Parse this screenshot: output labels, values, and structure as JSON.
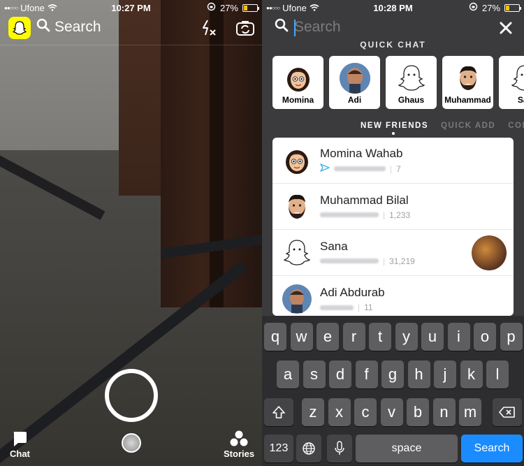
{
  "left": {
    "status": {
      "carrier": "Ufone",
      "time": "10:27 PM",
      "battery": "27%",
      "battery_level": 0.27
    },
    "search_label": "Search",
    "icons": {
      "ghost": "snapchat-ghost-icon",
      "search": "search-icon",
      "flash": "flash-off-icon",
      "flip": "flip-camera-icon",
      "chat": "chat-icon",
      "stories": "stories-icon"
    },
    "bottom": {
      "chat": "Chat",
      "stories": "Stories"
    }
  },
  "right": {
    "status": {
      "carrier": "Ufone",
      "time": "10:28 PM",
      "battery": "27%",
      "battery_level": 0.27
    },
    "search": {
      "placeholder": "Search"
    },
    "quick_chat_title": "QUICK CHAT",
    "quick_chat": [
      {
        "name": "Momina",
        "avatar": "bitmoji-female-icon"
      },
      {
        "name": "Adi",
        "avatar": "photo-face-icon"
      },
      {
        "name": "Ghaus",
        "avatar": "ghost-icon"
      },
      {
        "name": "Muhammad",
        "avatar": "bitmoji-male-icon"
      },
      {
        "name": "Sar",
        "avatar": "ghost-icon"
      }
    ],
    "tabs": [
      {
        "label": "NEW FRIENDS",
        "active": true
      },
      {
        "label": "QUICK ADD",
        "active": false
      },
      {
        "label": "CONT",
        "active": false
      }
    ],
    "friends": [
      {
        "name": "Momina Wahab",
        "score": "7",
        "avatar": "bitmoji-female-icon",
        "status_icon": "sent-arrow-icon"
      },
      {
        "name": "Muhammad Bilal",
        "score": "1,233",
        "avatar": "bitmoji-male-icon"
      },
      {
        "name": "Sana",
        "score": "31,219",
        "avatar": "ghost-icon",
        "has_story": true
      },
      {
        "name": "Adi Abdurab",
        "score": "11",
        "avatar": "photo-face-icon"
      }
    ],
    "keyboard": {
      "row1": [
        "q",
        "w",
        "e",
        "r",
        "t",
        "y",
        "u",
        "i",
        "o",
        "p"
      ],
      "row2": [
        "a",
        "s",
        "d",
        "f",
        "g",
        "h",
        "j",
        "k",
        "l"
      ],
      "row3": [
        "z",
        "x",
        "c",
        "v",
        "b",
        "n",
        "m"
      ],
      "numbers": "123",
      "space": "space",
      "search": "Search",
      "icons": {
        "shift": "shift-icon",
        "delete": "backspace-icon",
        "globe": "globe-icon",
        "mic": "microphone-icon"
      }
    }
  }
}
